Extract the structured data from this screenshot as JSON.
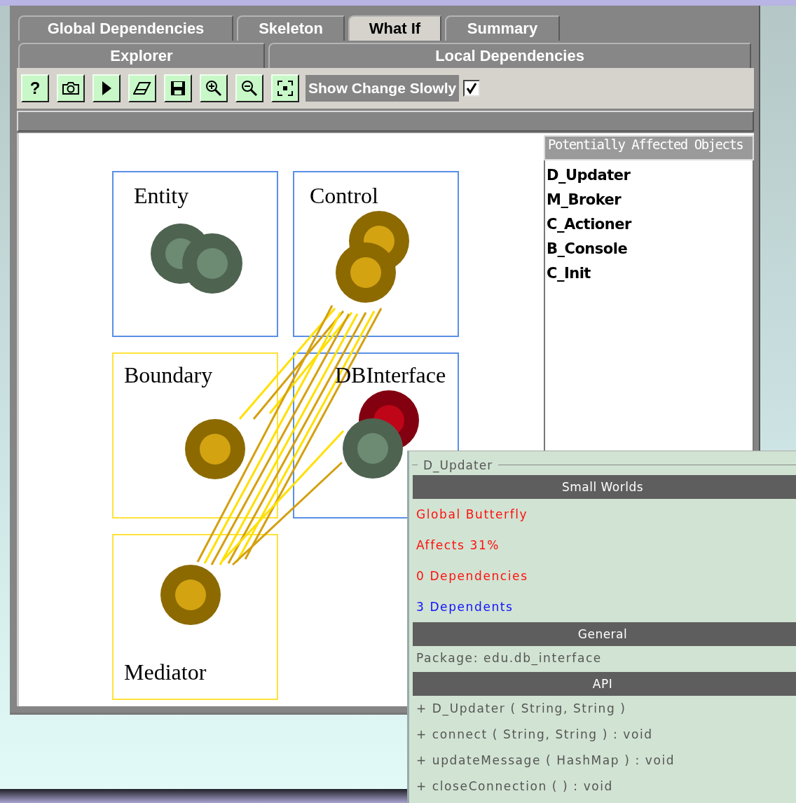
{
  "tab_rows": [
    {
      "tabs": [
        {
          "label": "Global Dependencies",
          "selected": false
        },
        {
          "label": "Skeleton",
          "selected": false
        },
        {
          "label": "What If",
          "selected": true
        },
        {
          "label": "Summary",
          "selected": false
        }
      ]
    },
    {
      "tabs": [
        {
          "label": "Explorer",
          "selected": false
        },
        {
          "label": "Local Dependencies",
          "selected": false
        }
      ]
    }
  ],
  "toolbar": {
    "buttons": [
      {
        "kind": "help",
        "label": "?"
      },
      {
        "kind": "camera"
      },
      {
        "kind": "play"
      },
      {
        "kind": "eraser"
      },
      {
        "kind": "save"
      },
      {
        "kind": "zoom-in"
      },
      {
        "kind": "zoom-out"
      },
      {
        "kind": "fit"
      }
    ],
    "show_change_slowly": {
      "label": "Show Change Slowly",
      "checked": true
    }
  },
  "diagram": {
    "packages": [
      {
        "label": "Entity",
        "color": "#5a8fe6"
      },
      {
        "label": "Control",
        "color": "#5a8fe6"
      },
      {
        "label": "Boundary",
        "color": "#ffe23a"
      },
      {
        "label": "DBInterface",
        "color": "#5a8fe6"
      },
      {
        "label": "Mediator",
        "color": "#ffe23a"
      }
    ]
  },
  "affected_objects": {
    "heading": "Potentially Affected Objects",
    "items": [
      "D_Updater",
      "M_Broker",
      "C_Actioner",
      "B_Console",
      "C_Init"
    ]
  },
  "popup": {
    "title": "D_Updater",
    "sections": [
      {
        "heading": "Small Worlds",
        "items": [
          {
            "text": "Global Butterfly",
            "color": "#ff1010"
          },
          {
            "text": "Affects 31%",
            "color": "#ff1010"
          },
          {
            "text": "0 Dependencies",
            "color": "#ff1010"
          },
          {
            "text": "3 Dependents",
            "color": "#1010ff"
          }
        ]
      },
      {
        "heading": "General",
        "items": [
          {
            "text": "Package: edu.db_interface"
          }
        ]
      },
      {
        "heading": "API",
        "items": [
          {
            "text": "+ D_Updater ( String, String )"
          },
          {
            "text": "+ connect ( String, String )  : void"
          },
          {
            "text": "+ updateMessage ( HashMap )  : void"
          },
          {
            "text": "+ closeConnection ( )  : void"
          }
        ]
      }
    ]
  }
}
